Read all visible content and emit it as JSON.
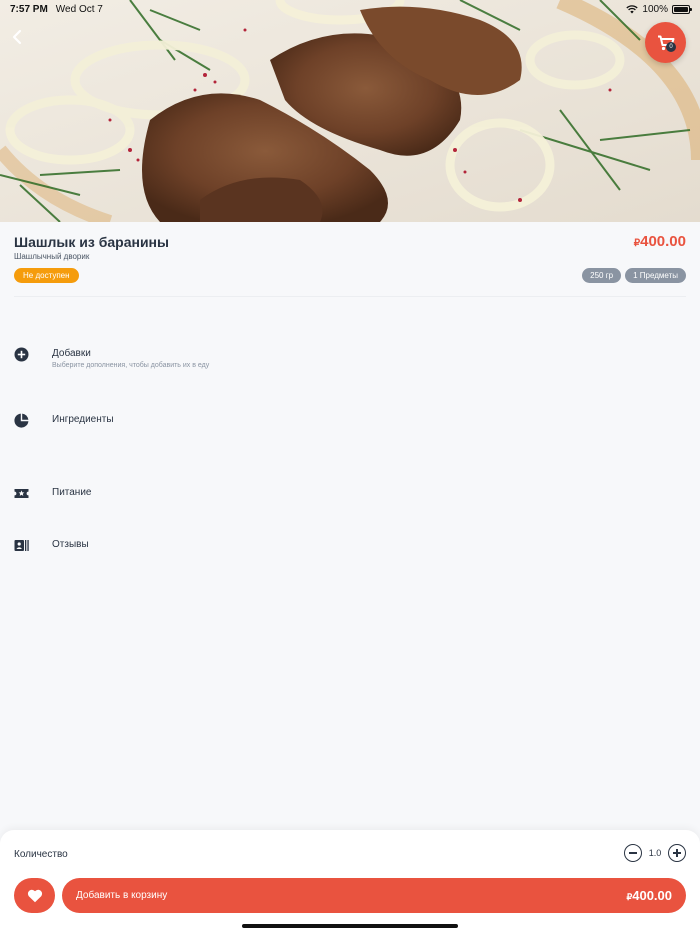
{
  "status_bar": {
    "time": "7:57 PM",
    "date": "Wed Oct 7",
    "battery": "100%"
  },
  "header": {
    "cart_count": "0"
  },
  "product": {
    "title": "Шашлык из баранины",
    "vendor": "Шашлычный дворик",
    "currency_symbol": "₽",
    "price": "400.00",
    "availability_badge": "Не доступен",
    "chips": [
      "250 гр",
      "1 Предметы"
    ]
  },
  "sections": [
    {
      "label": "Добавки",
      "subtitle": "Выберите дополнения, чтобы добавить их в еду",
      "icon": "plus-circle-icon"
    },
    {
      "label": "Ингредиенты",
      "icon": "pie-chart-icon"
    },
    {
      "label": "Питание",
      "icon": "ticket-star-icon"
    },
    {
      "label": "Отзывы",
      "icon": "reviews-card-icon"
    }
  ],
  "bottom": {
    "quantity_label": "Количество",
    "quantity_value": "1.0",
    "add_to_cart_label": "Добавить в корзину",
    "currency_symbol": "₽",
    "total_price": "400.00"
  },
  "colors": {
    "accent": "#e9533f",
    "badge_orange": "#f59c0c",
    "chip_gray": "#8a94a2",
    "text_dark": "#2a3443"
  }
}
